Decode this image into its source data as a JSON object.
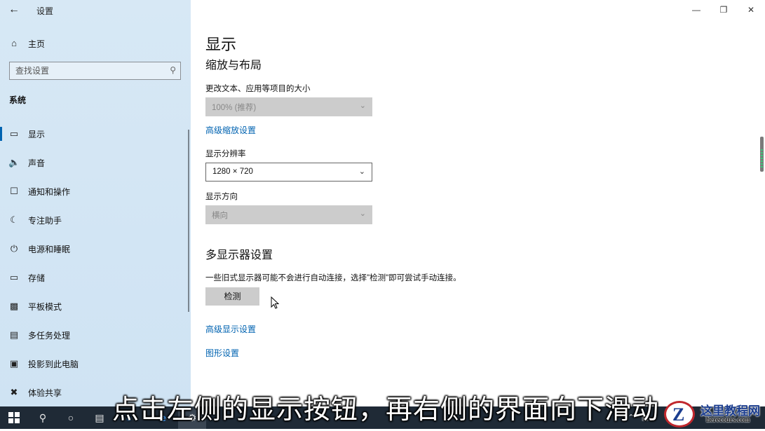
{
  "window": {
    "title": "设置",
    "back_icon": "arrow-left-icon"
  },
  "sidebar": {
    "home": {
      "label": "主页",
      "icon": "home-icon"
    },
    "search": {
      "placeholder": "查找设置",
      "icon": "search-icon"
    },
    "section_title": "系统",
    "items": [
      {
        "label": "显示",
        "icon": "monitor-icon",
        "active": true
      },
      {
        "label": "声音",
        "icon": "speaker-icon"
      },
      {
        "label": "通知和操作",
        "icon": "notification-icon"
      },
      {
        "label": "专注助手",
        "icon": "moon-icon"
      },
      {
        "label": "电源和睡眠",
        "icon": "power-icon"
      },
      {
        "label": "存储",
        "icon": "storage-icon"
      },
      {
        "label": "平板模式",
        "icon": "tablet-icon"
      },
      {
        "label": "多任务处理",
        "icon": "multitask-icon"
      },
      {
        "label": "投影到此电脑",
        "icon": "project-icon"
      },
      {
        "label": "体验共享",
        "icon": "share-icon"
      }
    ]
  },
  "main": {
    "page_title": "显示",
    "scale_layout": {
      "heading": "缩放与布局",
      "text_size_label": "更改文本、应用等项目的大小",
      "text_size_value": "100% (推荐)",
      "advanced_scaling_link": "高级缩放设置",
      "resolution_label": "显示分辨率",
      "resolution_value": "1280 × 720",
      "orientation_label": "显示方向",
      "orientation_value": "横向"
    },
    "multi_display": {
      "heading": "多显示器设置",
      "description": "一些旧式显示器可能不会进行自动连接，选择\"检测\"即可尝试手动连接。",
      "detect_button": "检测",
      "advanced_display_link": "高级显示设置",
      "graphics_link": "图形设置"
    }
  },
  "overlay": {
    "subtitle": "点击左侧的显示按钮，再右侧的界面向下滑动",
    "watermark_title": "这里教程网",
    "watermark_url": "herecours.com"
  },
  "colors": {
    "accent": "#0063b1",
    "sidebar_bg": "#d3e6f4",
    "taskbar_bg": "#1f2a36"
  }
}
